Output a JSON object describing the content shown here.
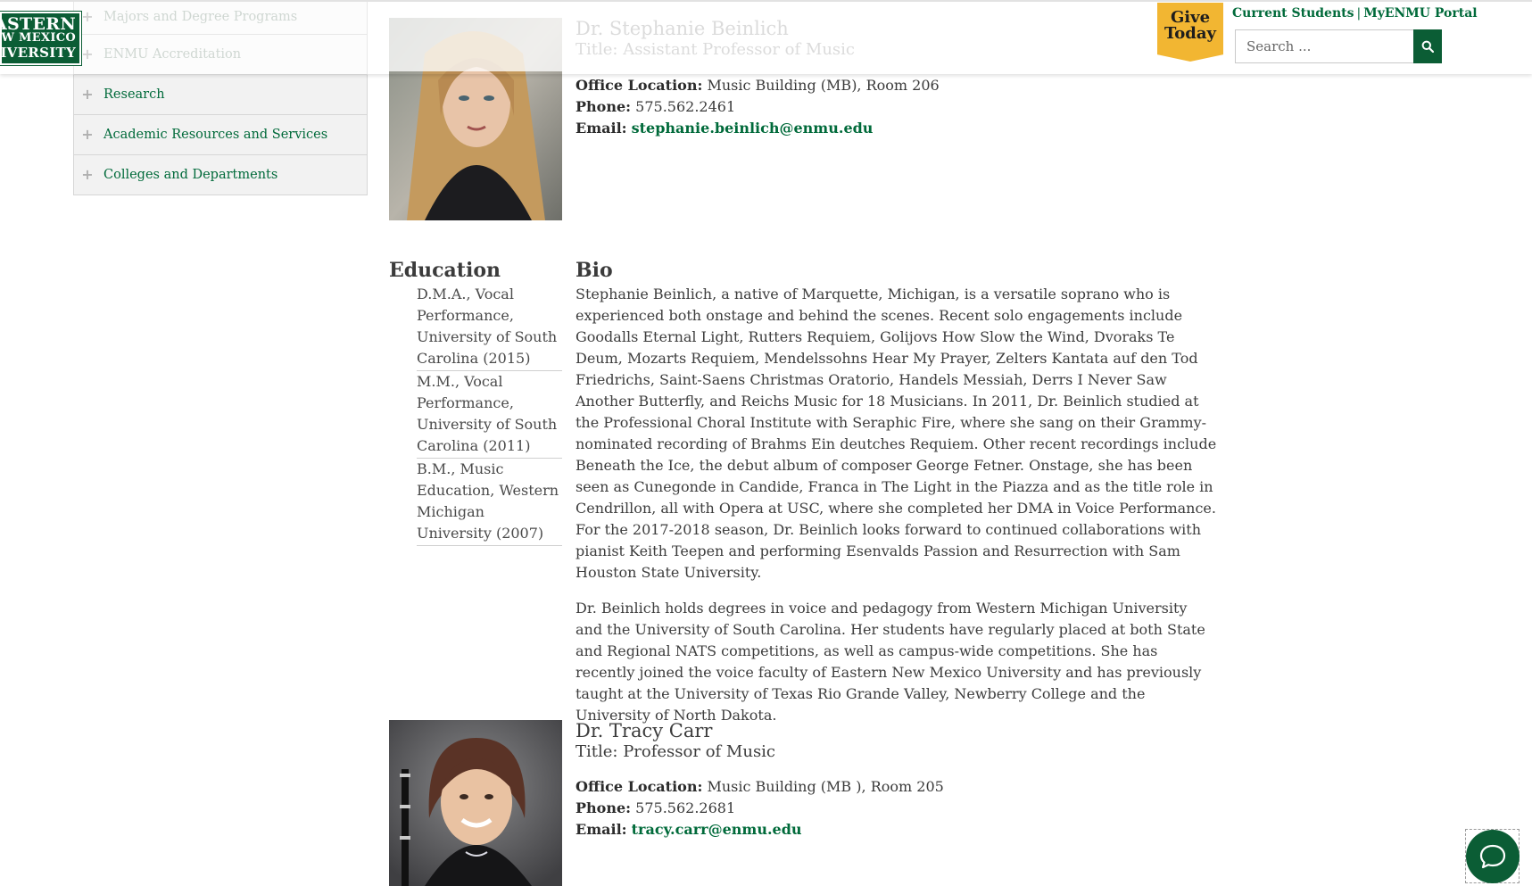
{
  "header": {
    "logo_lines": [
      "EASTERN",
      "NEW MEXICO",
      "UNIVERSITY"
    ],
    "give": [
      "Give",
      "Today"
    ],
    "links": [
      "Current Students",
      "MyENMU Portal"
    ],
    "link_separator": "|",
    "search": {
      "placeholder": "Search ..."
    },
    "brand_color": "#0b5d35",
    "give_color": "#f2b632"
  },
  "sidebar": {
    "items": [
      {
        "label": "Majors and Degree Programs"
      },
      {
        "label": "ENMU Accreditation"
      },
      {
        "label": "Research"
      },
      {
        "label": "Academic Resources and Services"
      },
      {
        "label": "Colleges and Departments"
      }
    ]
  },
  "profiles": [
    {
      "name": "Dr. Stephanie Beinlich",
      "title": "Title: Assistant Professor of Music",
      "office_label": "Office Location:",
      "office": "Music Building (MB), Room 206",
      "phone_label": "Phone:",
      "phone": "575.562.2461",
      "email_label": "Email:",
      "email": "stephanie.beinlich@enmu.edu"
    },
    {
      "name": "Dr. Tracy Carr",
      "title": "Title: Professor of Music",
      "office_label": "Office Location:",
      "office": "Music Building (MB ), Room 205",
      "phone_label": "Phone:",
      "phone": "575.562.2681",
      "email_label": "Email:",
      "email": "tracy.carr@enmu.edu"
    }
  ],
  "education": {
    "heading": "Education",
    "items": [
      "D.M.A., Vocal Performance, University of South Carolina (2015)",
      "M.M., Vocal Performance, University of South Carolina (2011)",
      "B.M., Music Education, Western Michigan University (2007)"
    ]
  },
  "bio": {
    "heading": "Bio",
    "paragraphs": [
      "Stephanie Beinlich, a native of Marquette, Michigan, is a versatile soprano who is experienced both onstage and behind the scenes. Recent solo engagements include Goodalls Eternal Light, Rutters Requiem, Golijovs How Slow the Wind, Dvoraks Te Deum, Mozarts Requiem, Mendelssohns Hear My Prayer, Zelters Kantata auf den Tod Friedrichs, Saint-Saens Christmas Oratorio, Handels Messiah, Derrs I Never Saw Another Butterfly, and Reichs Music for 18 Musicians. In 2011, Dr. Beinlich studied at the Professional Choral Institute with Seraphic Fire, where she sang on their Grammy-nominated recording of Brahms Ein deutches Requiem. Other recent recordings include Beneath the Ice, the debut album of composer George Fetner. Onstage, she has been seen as Cunegonde in Candide, Franca in The Light in the Piazza and as the title role in Cendrillon, all with Opera at USC, where she completed her DMA in Voice Performance. For the 2017-2018 season, Dr. Beinlich looks forward to continued collaborations with pianist Keith Teepen and performing Esenvalds Passion and Resurrection with Sam Houston State University.",
      "Dr. Beinlich holds degrees in voice and pedagogy from Western Michigan University and the University of South Carolina. Her students have regularly placed at both State and Regional NATS competitions, as well as campus-wide competitions. She has recently joined the voice faculty of Eastern New Mexico University and has previously taught at the University of Texas Rio Grande Valley, Newberry College and the University of North Dakota."
    ]
  },
  "icons": {
    "sidebar_expand": "plus-icon",
    "search": "search-icon",
    "chat": "chat-icon"
  }
}
